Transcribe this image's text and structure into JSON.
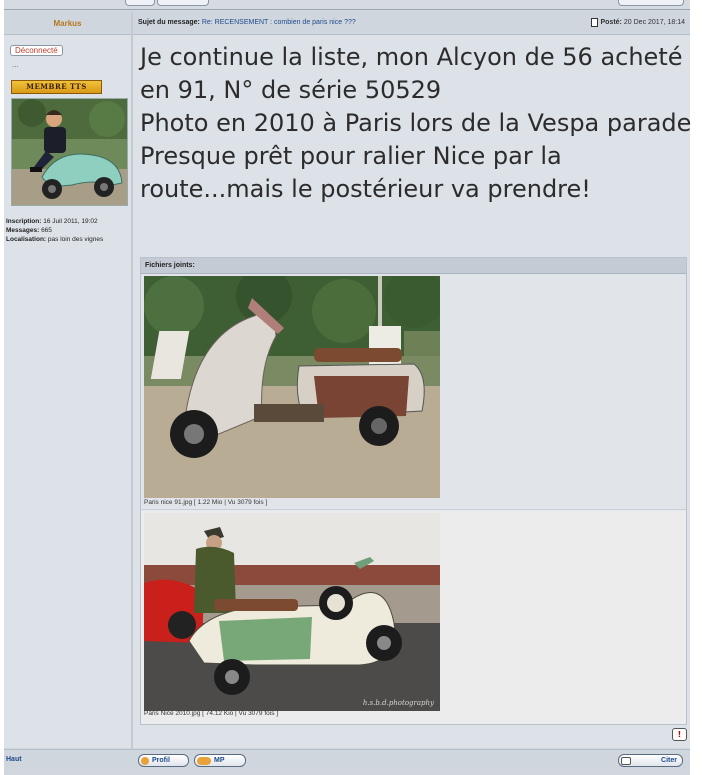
{
  "post": {
    "author": "Markus",
    "subject_label": "Sujet du message:",
    "subject": "Re: RECENSEMENT : combien de paris nice ???",
    "posted_label": "Posté:",
    "posted_date": "20 Dec 2017, 18:14",
    "message_lines": [
      "Je continue la liste, mon Alcyon de 56 acheté",
      "en 91, N° de série 50529",
      "Photo en 2010 à Paris lors de la Vespa parade",
      "Presque prêt pour ralier Nice par la",
      "route...mais le postérieur va prendre!"
    ]
  },
  "profile": {
    "status": "Déconnecté",
    "dots": "...",
    "rank": "MEMBRE TTS",
    "inscription_label": "Inscription:",
    "inscription": "16 Juil 2011, 19:02",
    "messages_label": "Messages:",
    "messages": "665",
    "localisation_label": "Localisation:",
    "localisation": "pas loin des vignes"
  },
  "attachments": {
    "header": "Fichiers joints:",
    "files": [
      {
        "caption": "Paris nice 91.jpg [ 1.22 Mio | Vu 3079 fois ]"
      },
      {
        "caption": "Paris Nice 2010.jpg [ 74.12 Kio | Vu 3079 fois ]",
        "watermark": "h.s.b.d.photography"
      }
    ]
  },
  "footer": {
    "top_link": "Haut",
    "profile_button": "Profil",
    "pm_button": "MP",
    "quote_button": "Citer"
  },
  "colors": {
    "author": "#b4781e",
    "link": "#1f4a8c",
    "offline": "#c0392b",
    "body_bg": "#dde2e8"
  },
  "icons": [
    "doc-icon",
    "report-icon",
    "profile-icon",
    "pm-icon",
    "quote-icon"
  ]
}
